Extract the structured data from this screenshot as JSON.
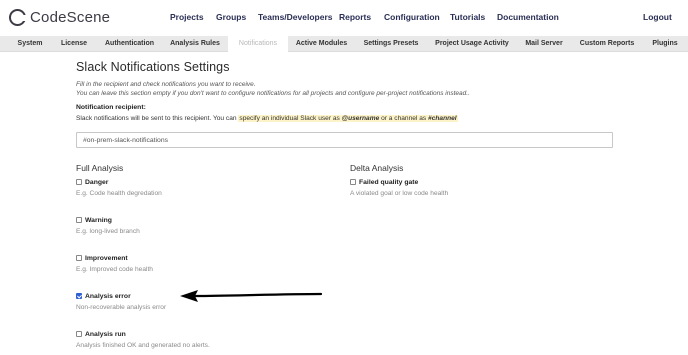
{
  "brand": {
    "name": "CodeScene"
  },
  "nav": {
    "items": [
      "Projects",
      "Groups",
      "Teams/Developers",
      "Reports",
      "Configuration",
      "Tutorials",
      "Documentation"
    ],
    "logout": "Logout"
  },
  "tabs": [
    {
      "label": "System",
      "active": false
    },
    {
      "label": "License",
      "active": false
    },
    {
      "label": "Authentication",
      "active": false
    },
    {
      "label": "Analysis Rules",
      "active": false
    },
    {
      "label": "Notifications",
      "active": true
    },
    {
      "label": "Active Modules",
      "active": false
    },
    {
      "label": "Settings Presets",
      "active": false
    },
    {
      "label": "Project Usage Activity",
      "active": false
    },
    {
      "label": "Mail Server",
      "active": false
    },
    {
      "label": "Custom Reports",
      "active": false
    },
    {
      "label": "Plugins",
      "active": false
    }
  ],
  "page": {
    "title": "Slack Notifications Settings",
    "intro_line1": "Fill in the recipient and check notifications you want to receive.",
    "intro_line2": "You can leave this section empty if you don't want to configure notifications for all projects and configure per-project notifications instead..",
    "recipient_label": "Notification recipient:",
    "recipient_help_prefix": "Slack notifications will be sent to this recipient. You can",
    "recipient_help_hl1": "specify an individual Slack user as",
    "recipient_help_user": "@username",
    "recipient_help_mid": "or a channel as",
    "recipient_help_channel": "#channel",
    "recipient_value": "#on-prem-slack-notifications"
  },
  "full_analysis": {
    "title": "Full Analysis",
    "options": [
      {
        "label": "Danger",
        "desc": "E.g. Code health degredation",
        "checked": false
      },
      {
        "label": "Warning",
        "desc": "E.g. long-lived branch",
        "checked": false
      },
      {
        "label": "Improvement",
        "desc": "E.g. Improved code health",
        "checked": false
      },
      {
        "label": "Analysis error",
        "desc": "Non-recoverable analysis error",
        "checked": true
      },
      {
        "label": "Analysis run",
        "desc": "Analysis finished OK and generated no alerts.",
        "checked": false
      }
    ]
  },
  "delta_analysis": {
    "title": "Delta Analysis",
    "options": [
      {
        "label": "Failed quality gate",
        "desc": "A violated goal or low code health",
        "checked": false
      }
    ]
  },
  "colors": {
    "nav_text": "#2a2f55",
    "tab_bg": "#e9e9e9",
    "highlight": "#fdf3c8",
    "checkbox_checked": "#2f5fd0"
  }
}
